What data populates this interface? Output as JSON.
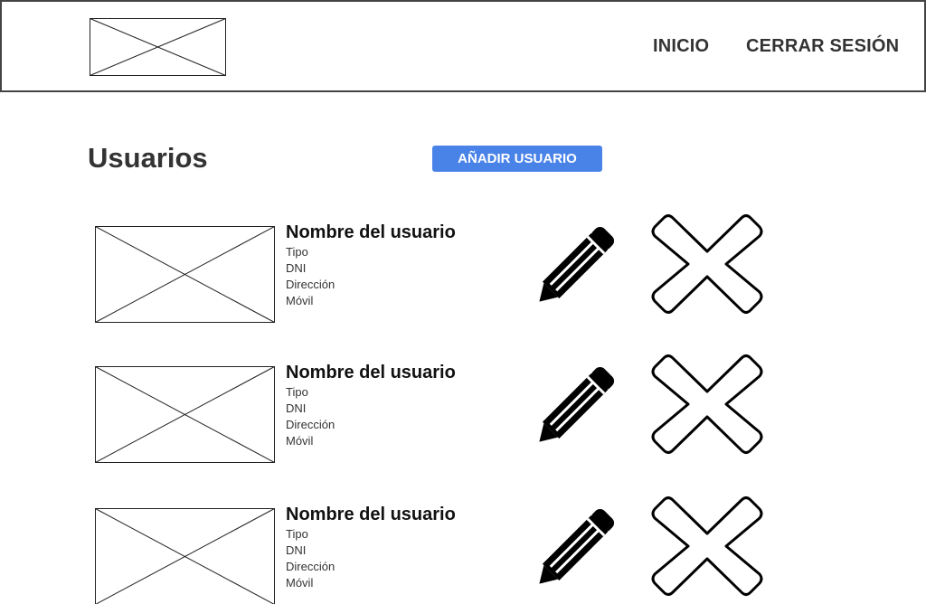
{
  "header": {
    "nav": {
      "home_label": "INICIO",
      "logout_label": "CERRAR SESIÓN"
    }
  },
  "main": {
    "title": "Usuarios",
    "add_button_label": "AÑADIR USUARIO",
    "accent_color": "#4a83e8",
    "users": [
      {
        "name": "Nombre del usuario",
        "type": "Tipo",
        "dni": "DNI",
        "address": "Dirección",
        "mobile": "Móvil"
      },
      {
        "name": "Nombre del usuario",
        "type": "Tipo",
        "dni": "DNI",
        "address": "Dirección",
        "mobile": "Móvil"
      },
      {
        "name": "Nombre del usuario",
        "type": "Tipo",
        "dni": "DNI",
        "address": "Dirección",
        "mobile": "Móvil"
      }
    ],
    "row_icons": {
      "edit": "pencil-icon",
      "delete": "x-icon"
    }
  }
}
